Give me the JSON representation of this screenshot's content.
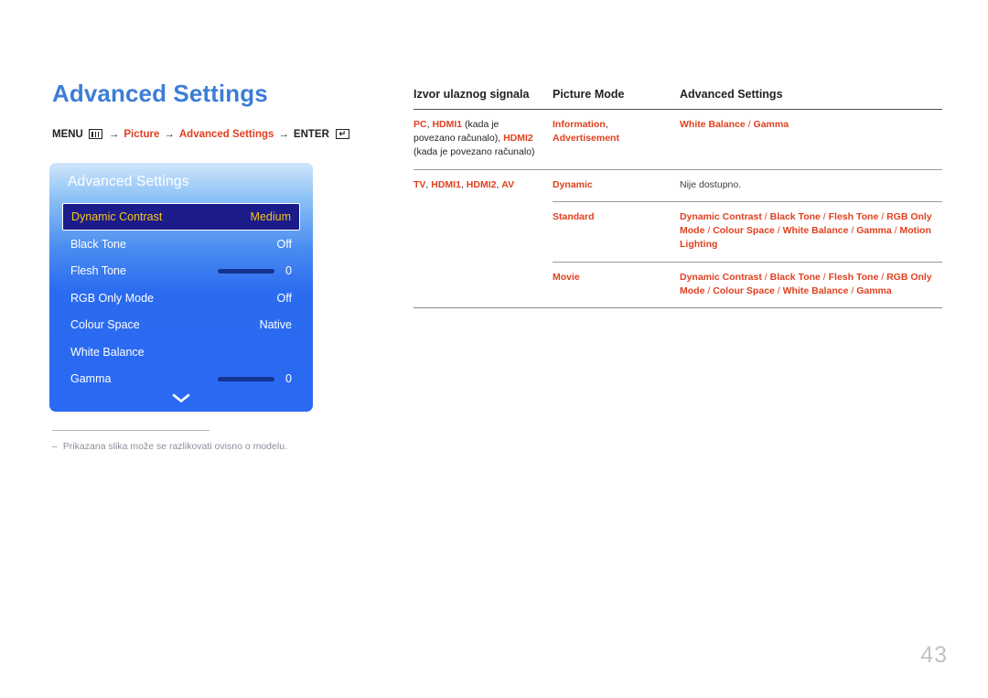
{
  "page": {
    "title": "Advanced Settings",
    "number": "43"
  },
  "breadcrumb": {
    "menu_label": "MENU",
    "menu_icon": "menu-grid-icon",
    "arrow": "→",
    "item_picture": "Picture",
    "item_advanced_settings": "Advanced Settings",
    "enter_label": "ENTER",
    "enter_icon": "enter-return-icon",
    "accent_color": "#e0401f"
  },
  "tv_panel": {
    "title": "Advanced Settings",
    "chevron_icon": "chevron-down-icon",
    "selected_index": 0,
    "highlight_bg": "#1b1b8a",
    "highlight_text": "#f5c518",
    "rows": [
      {
        "label": "Dynamic Contrast",
        "value": "Medium",
        "type": "value",
        "selected": true
      },
      {
        "label": "Black Tone",
        "value": "Off",
        "type": "value",
        "selected": false
      },
      {
        "label": "Flesh Tone",
        "value": "0",
        "type": "slider",
        "selected": false
      },
      {
        "label": "RGB Only Mode",
        "value": "Off",
        "type": "value",
        "selected": false
      },
      {
        "label": "Colour Space",
        "value": "Native",
        "type": "value",
        "selected": false
      },
      {
        "label": "White Balance",
        "value": "",
        "type": "value",
        "selected": false
      },
      {
        "label": "Gamma",
        "value": "0",
        "type": "slider",
        "selected": false
      }
    ]
  },
  "footnote": {
    "dash": "–",
    "text": "Prikazana slika može se razlikovati ovisno o modelu."
  },
  "table": {
    "headers": {
      "col1": "Izvor ulaznog signala",
      "col2": "Picture Mode",
      "col3": "Advanced Settings"
    },
    "rows": [
      {
        "col1": [
          {
            "t": "PC",
            "s": "red"
          },
          {
            "t": ", ",
            "s": "blk"
          },
          {
            "t": "HDMI1",
            "s": "red"
          },
          {
            "t": " (kada je povezano računalo), ",
            "s": "blk"
          },
          {
            "t": "HDMI2",
            "s": "red"
          },
          {
            "t": " (kada je povezano računalo)",
            "s": "blk"
          }
        ],
        "col2": [
          {
            "t": "Information",
            "s": "red"
          },
          {
            "t": ",",
            "s": "blk"
          },
          {
            "t": " Advertisement",
            "s": "red"
          }
        ],
        "col3": [
          {
            "t": "White Balance",
            "s": "red"
          },
          {
            "t": " / ",
            "s": "slash"
          },
          {
            "t": "Gamma",
            "s": "red"
          }
        ],
        "divider": "none"
      },
      {
        "col1": [
          {
            "t": "TV",
            "s": "red"
          },
          {
            "t": ", ",
            "s": "blk"
          },
          {
            "t": "HDMI1",
            "s": "red"
          },
          {
            "t": ", ",
            "s": "blk"
          },
          {
            "t": "HDMI2",
            "s": "red"
          },
          {
            "t": ", ",
            "s": "blk"
          },
          {
            "t": "AV",
            "s": "red"
          }
        ],
        "col2": [
          {
            "t": "Dynamic",
            "s": "red"
          }
        ],
        "col3": [
          {
            "t": "Nije dostupno.",
            "s": "note"
          }
        ],
        "divider": "full"
      },
      {
        "col1": [],
        "col2": [
          {
            "t": "Standard",
            "s": "red"
          }
        ],
        "col3": [
          {
            "t": "Dynamic Contrast",
            "s": "red"
          },
          {
            "t": " / ",
            "s": "slash"
          },
          {
            "t": "Black Tone",
            "s": "red"
          },
          {
            "t": " / ",
            "s": "slash"
          },
          {
            "t": "Flesh Tone",
            "s": "red"
          },
          {
            "t": " / ",
            "s": "slash"
          },
          {
            "t": "RGB Only Mode",
            "s": "red"
          },
          {
            "t": " / ",
            "s": "slash"
          },
          {
            "t": "Colour Space",
            "s": "red"
          },
          {
            "t": " / ",
            "s": "slash"
          },
          {
            "t": "White Balance",
            "s": "red"
          },
          {
            "t": " / ",
            "s": "slash"
          },
          {
            "t": "Gamma",
            "s": "red"
          },
          {
            "t": " / ",
            "s": "slash"
          },
          {
            "t": "Motion Lighting",
            "s": "red"
          }
        ],
        "divider": "partial"
      },
      {
        "col1": [],
        "col2": [
          {
            "t": "Movie",
            "s": "red"
          }
        ],
        "col3": [
          {
            "t": "Dynamic Contrast",
            "s": "red"
          },
          {
            "t": " / ",
            "s": "slash"
          },
          {
            "t": "Black Tone",
            "s": "red"
          },
          {
            "t": " / ",
            "s": "slash"
          },
          {
            "t": "Flesh Tone",
            "s": "red"
          },
          {
            "t": " / ",
            "s": "slash"
          },
          {
            "t": "RGB Only Mode",
            "s": "red"
          },
          {
            "t": " / ",
            "s": "slash"
          },
          {
            "t": "Colour Space",
            "s": "red"
          },
          {
            "t": " / ",
            "s": "slash"
          },
          {
            "t": "White Balance",
            "s": "red"
          },
          {
            "t": " / ",
            "s": "slash"
          },
          {
            "t": "Gamma",
            "s": "red"
          }
        ],
        "divider": "partial"
      }
    ]
  }
}
